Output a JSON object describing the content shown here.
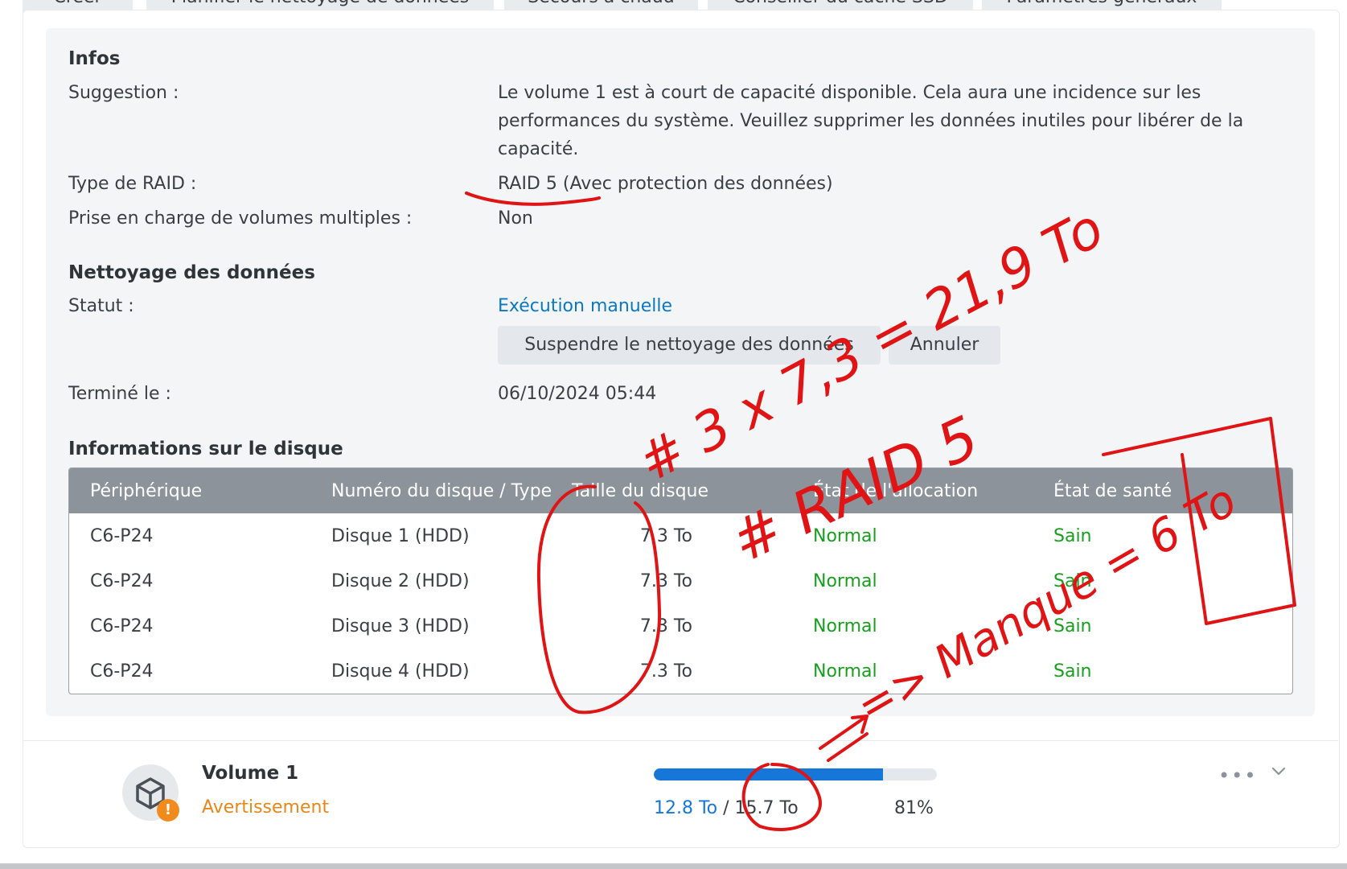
{
  "toolbar": {
    "buttons": [
      {
        "label": "Créer"
      },
      {
        "label": "Planifier le nettoyage de données"
      },
      {
        "label": "Secours à chaud"
      },
      {
        "label": "Conseiller du cache SSD"
      },
      {
        "label": "Paramètres généraux"
      }
    ]
  },
  "infos": {
    "title": "Infos",
    "suggestion_label": "Suggestion :",
    "suggestion_line1": "Le volume 1 est à court de capacité disponible. Cela aura une incidence sur les",
    "suggestion_line2": "performances du système. Veuillez supprimer les données inutiles pour libérer de la",
    "suggestion_line3": "capacité.",
    "raid_label": "Type de RAID :",
    "raid_value": "RAID 5 (Avec protection des données)",
    "multi_label": "Prise en charge de volumes multiples :",
    "multi_value": "Non"
  },
  "scrub": {
    "title": "Nettoyage des données",
    "status_label": "Statut :",
    "status_value": "Exécution manuelle",
    "suspend_label": "Suspendre le nettoyage des données",
    "cancel_label": "Annuler",
    "done_label": "Terminé le :",
    "done_value": "06/10/2024 05:44"
  },
  "disks": {
    "title": "Informations sur le disque",
    "headers": [
      "Périphérique",
      "Numéro du disque / Type",
      "Taille du disque",
      "État de l'allocation",
      "État de santé"
    ],
    "rows": [
      {
        "device": "C6-P24",
        "disk": "Disque 1 (HDD)",
        "size": "7.3 To",
        "alloc": "Normal",
        "health": "Sain"
      },
      {
        "device": "C6-P24",
        "disk": "Disque 2 (HDD)",
        "size": "7.3 To",
        "alloc": "Normal",
        "health": "Sain"
      },
      {
        "device": "C6-P24",
        "disk": "Disque 3 (HDD)",
        "size": "7.3 To",
        "alloc": "Normal",
        "health": "Sain"
      },
      {
        "device": "C6-P24",
        "disk": "Disque 4 (HDD)",
        "size": "7.3 To",
        "alloc": "Normal",
        "health": "Sain"
      }
    ]
  },
  "volume": {
    "name": "Volume 1",
    "status": "Avertissement",
    "used": "12.8 To",
    "separator": " / ",
    "total": "15.7 To",
    "percent_label": "81%",
    "usage_fraction": 0.81,
    "warn_glyph": "!"
  },
  "annotations": {
    "line1": "# 3 x 7,3 = 21,9 To",
    "line2": "# RAID 5",
    "line3": "=> Manque = 6 To"
  },
  "colors": {
    "accent": "#1677d8",
    "link": "#0b78c4",
    "healthy": "#16a01e",
    "warning": "#e8861a",
    "ink": "#e01414"
  }
}
